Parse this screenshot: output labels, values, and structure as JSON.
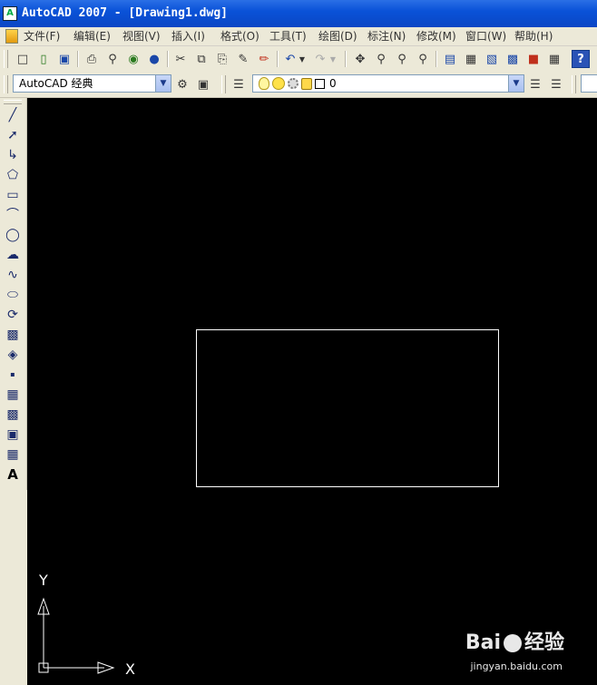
{
  "window": {
    "app_icon": "autocad-icon",
    "title": "AutoCAD 2007 - [Drawing1.dwg]"
  },
  "menubar": {
    "doc_icon": "document-icon",
    "items": [
      "文件(F)",
      "编辑(E)",
      "视图(V)",
      "插入(I)",
      "格式(O)",
      "工具(T)",
      "绘图(D)",
      "标注(N)",
      "修改(M)",
      "窗口(W)",
      "帮助(H)"
    ]
  },
  "standard_toolbar": {
    "buttons": [
      "new-icon",
      "open-icon",
      "save-icon",
      "plot-icon",
      "plot-preview-icon",
      "publish-icon",
      "3d-dwf-icon",
      "cut-icon",
      "copy-icon",
      "paste-icon",
      "match-properties-icon",
      "block-editor-icon",
      "undo-icon",
      "redo-icon",
      "pan-icon",
      "zoom-realtime-icon",
      "zoom-window-icon",
      "zoom-previous-icon",
      "properties-icon",
      "design-center-icon",
      "tool-palettes-icon",
      "sheet-set-icon",
      "markup-icon",
      "calculator-icon",
      "help-icon"
    ],
    "help_label": "?"
  },
  "workspace_toolbar": {
    "workspace_value": "AutoCAD 经典",
    "layer_value": "0"
  },
  "draw_toolbar": {
    "buttons": [
      "line-icon",
      "construction-line-icon",
      "polyline-icon",
      "polygon-icon",
      "rectangle-icon",
      "arc-icon",
      "circle-icon",
      "revision-cloud-icon",
      "spline-icon",
      "ellipse-icon",
      "ellipse-arc-icon",
      "insert-block-icon",
      "make-block-icon",
      "point-icon",
      "hatch-icon",
      "gradient-icon",
      "region-icon",
      "table-icon",
      "multiline-text-icon"
    ],
    "text_tool_label": "A"
  },
  "canvas": {
    "background": "#000000",
    "rectangle_color": "#ffffff",
    "ucs_x_label": "X",
    "ucs_y_label": "Y"
  },
  "watermark": {
    "brand": "Bai",
    "brand_suffix": "经验",
    "url": "jingyan.baidu.com"
  }
}
